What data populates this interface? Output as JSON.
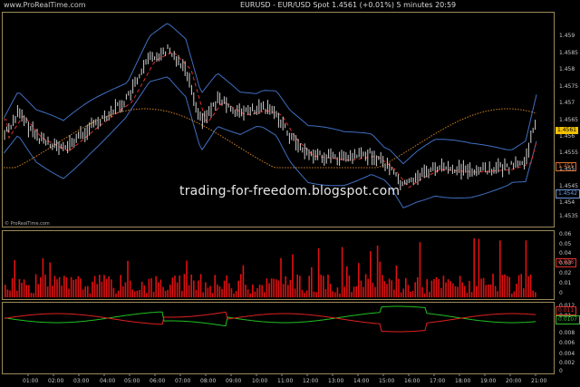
{
  "header": {
    "brand": "www.ProRealTime.com",
    "symbol_info": "EURUSD - EUR/USD Spot     1.4561 (+0.01%)     5 minutes  20:59"
  },
  "watermark": "trading-for-freedom.blogspot.com",
  "copyright": "© ProRealTime.com",
  "price_axis": [
    "1.459",
    "1.4585",
    "1.458",
    "1.4575",
    "1.457",
    "1.4565",
    "1.456",
    "1.4555",
    "1.455",
    "1.4545",
    "1.454",
    "1.4535"
  ],
  "price_tags": [
    {
      "text": "1.4561",
      "bg": "#f0c000",
      "fg": "#000"
    },
    {
      "text": "1.455",
      "bg": "#000",
      "fg": "#e07030"
    },
    {
      "text": "1.4542",
      "bg": "#000",
      "fg": "#6a9ae0"
    }
  ],
  "volume_axis": [
    "0.06",
    "0.05",
    "0.04",
    "0.03",
    "0.02",
    "0.01",
    "0"
  ],
  "volume_tag": {
    "text": "0.028",
    "fg": "#e03030"
  },
  "indicator_axis": [
    "0.012",
    "0.01",
    "0.008",
    "0.006",
    "0.004",
    "0.002",
    "0"
  ],
  "indicator_tags": [
    {
      "text": "0.011",
      "fg": "#e03030"
    },
    {
      "text": "0.0107",
      "fg": "#30c030"
    }
  ],
  "time_axis": [
    "01:00",
    "02:00",
    "03:00",
    "04:00",
    "05:00",
    "06:00",
    "07:00",
    "08:00",
    "09:00",
    "10:00",
    "11:00",
    "12:00",
    "13:00",
    "14:00",
    "15:00",
    "16:00",
    "17:00",
    "18:00",
    "19:00",
    "20:00",
    "21:00"
  ],
  "colors": {
    "candles": "#d0d0d0",
    "bollinger": "#3f6fc0",
    "ma_short": "#e03030",
    "ma_long": "#d08020",
    "volume": "#e01010",
    "line_green": "#20c020",
    "line_red": "#e02020",
    "frame": "#9a8a5a"
  }
}
